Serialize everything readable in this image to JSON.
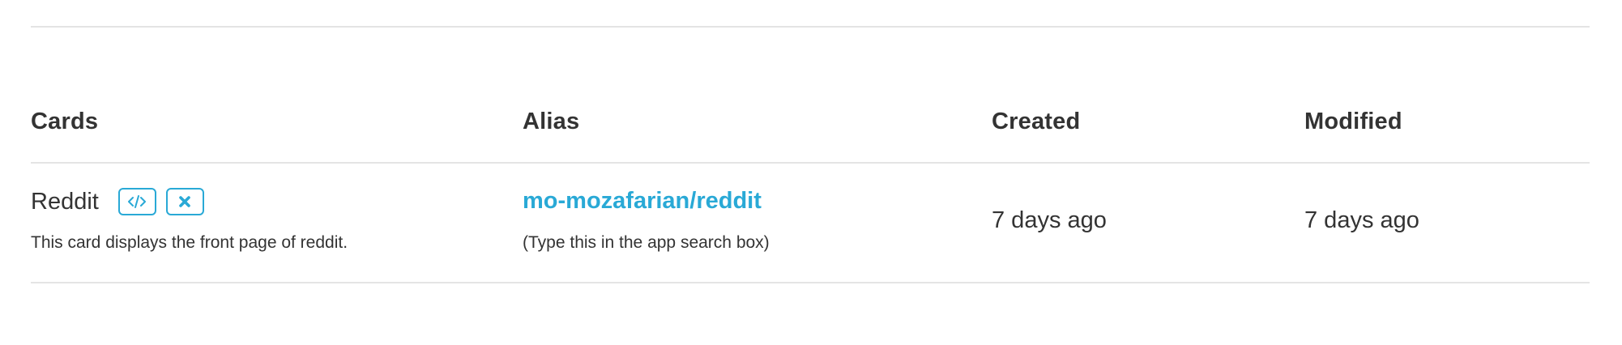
{
  "table": {
    "headers": {
      "cards": "Cards",
      "alias": "Alias",
      "created": "Created",
      "modified": "Modified"
    },
    "rows": [
      {
        "card_name": "Reddit",
        "description": "This card displays the front page of reddit.",
        "alias": "mo-mozafarian/reddit",
        "alias_hint": "(Type this in the app search box)",
        "created": "7 days ago",
        "modified": "7 days ago",
        "actions": {
          "embed_icon": "code-icon",
          "delete_icon": "close-icon"
        }
      }
    ]
  },
  "colors": {
    "accent": "#29a9d6",
    "text": "#333333",
    "divider": "#e4e4e4"
  }
}
